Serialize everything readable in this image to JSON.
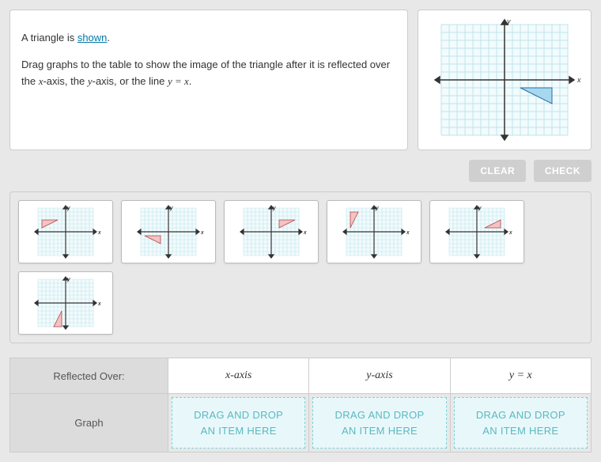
{
  "instructions": {
    "sentence1_pre": "A triangle is ",
    "sentence1_link": "shown",
    "sentence1_post": ".",
    "sentence2_pre": "Drag graphs to the table to show the image of the triangle after it is reflected over the ",
    "sentence2_mid": "-axis, the ",
    "sentence2_mid2": "-axis, or the line ",
    "sentence2_post": ".",
    "var_x": "x",
    "var_y": "y",
    "eq": "y = x"
  },
  "buttons": {
    "clear": "CLEAR",
    "check": "CHECK"
  },
  "labels": {
    "axis_x": "x",
    "axis_y": "y"
  },
  "table": {
    "row1_label": "Reflected Over:",
    "row2_label": "Graph",
    "col_x": "x-axis",
    "col_y": "y-axis",
    "col_eq": "y = x",
    "drop_line1": "DRAG AND DROP",
    "drop_line2": "AN ITEM HERE"
  },
  "chart_data": {
    "reference": {
      "type": "scatter",
      "title": "",
      "xlabel": "x",
      "ylabel": "y",
      "xlim": [
        -8,
        8
      ],
      "ylim": [
        -8,
        8
      ],
      "series": [
        {
          "name": "triangle",
          "points": [
            [
              2,
              -1
            ],
            [
              6,
              -1
            ],
            [
              6,
              -3
            ]
          ]
        }
      ]
    },
    "options": [
      {
        "id": "opt1",
        "quadrant": "II",
        "points": [
          [
            -6,
            3
          ],
          [
            -2,
            3
          ],
          [
            -6,
            1
          ]
        ]
      },
      {
        "id": "opt2",
        "quadrant": "III",
        "points": [
          [
            -6,
            -1
          ],
          [
            -2,
            -1
          ],
          [
            -2,
            -3
          ]
        ]
      },
      {
        "id": "opt3",
        "quadrant": "I",
        "points": [
          [
            2,
            3
          ],
          [
            6,
            3
          ],
          [
            2,
            1
          ]
        ]
      },
      {
        "id": "opt4",
        "quadrant": "II",
        "points": [
          [
            -6,
            1
          ],
          [
            -6,
            5
          ],
          [
            -4,
            5
          ]
        ]
      },
      {
        "id": "opt5",
        "quadrant": "I",
        "points": [
          [
            2,
            1
          ],
          [
            6,
            1
          ],
          [
            6,
            3
          ]
        ]
      },
      {
        "id": "opt6",
        "quadrant": "III",
        "points": [
          [
            -1,
            -2
          ],
          [
            -1,
            -6
          ],
          [
            -3,
            -6
          ]
        ]
      }
    ]
  }
}
